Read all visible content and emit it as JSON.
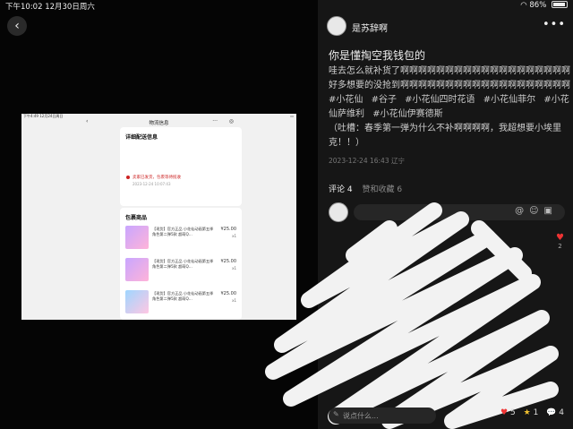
{
  "status_left": "下午10:02  12月30日周六",
  "status_right": {
    "battery": "86%"
  },
  "viewer": {
    "shot": {
      "status": "下午4:49  12月24日周日",
      "title": "物流信息",
      "delivery_heading": "详细配送信息",
      "warn": "卖家已发货，包裹等待揽收",
      "warn_time": "2023-12-24 10:07:43",
      "items_heading": "包裹商品",
      "item_name": "【现货】官方正品 小花仙动画第五季 角色第二弹5款 超萌Q...",
      "item_price": "¥25.00",
      "item_qty": "x1"
    }
  },
  "post": {
    "author": "是苏辞啊",
    "title": "你是懂掏空我钱包的",
    "body": "哇去怎么就补货了啊啊啊啊啊啊啊啊啊啊啊啊啊啊啊啊啊啊啊好多想要的没抢到啊啊啊啊啊啊啊啊啊啊啊啊啊啊啊啊啊啊啊",
    "tags": [
      "#小花仙",
      "#谷子",
      "#小花仙四时花语",
      "#小花仙菲尔",
      "#小花仙萨维利",
      "#小花仙伊赛德斯"
    ],
    "note": "（吐槽：春季第一弹为什么不补啊啊啊啊，我超想要小埃里克！！）",
    "meta": "2023-12-24 16:43 辽宁"
  },
  "comments": {
    "tab_comments": "评论 4",
    "tab_likes": "赞和收藏 6",
    "side_like_count": "2"
  },
  "bottom": {
    "say_placeholder": "说点什么...",
    "likes": "5",
    "stars": "1",
    "comments": "4"
  },
  "colors": {
    "like": "#e33333",
    "star": "#f0c030"
  }
}
